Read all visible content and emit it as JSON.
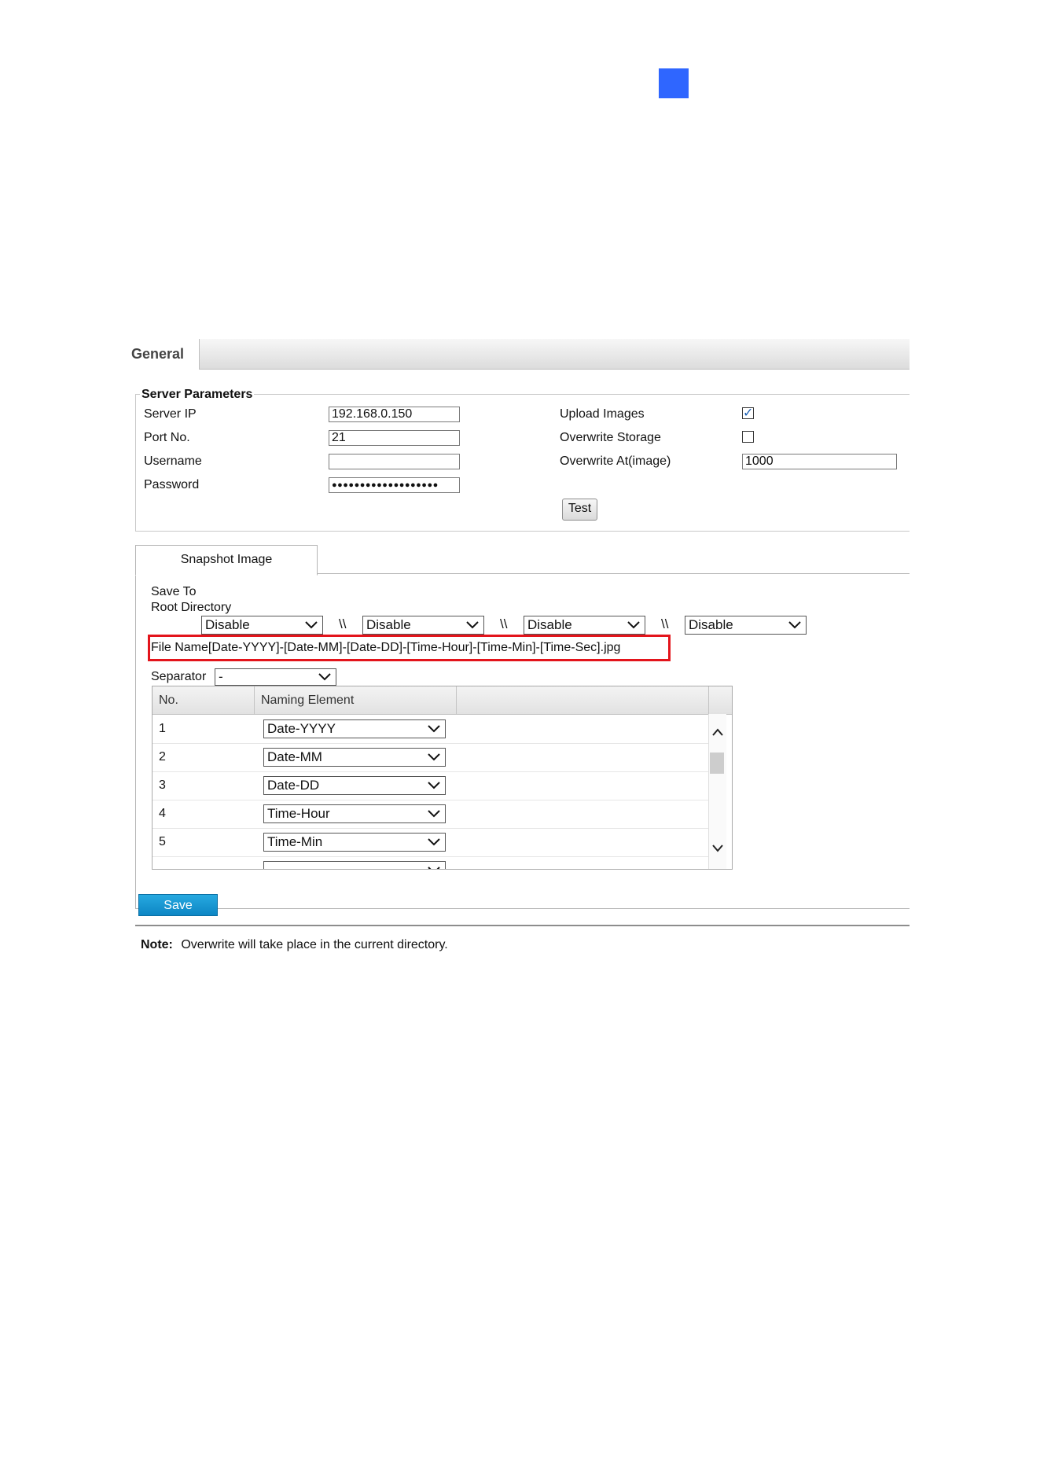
{
  "tabs": {
    "general": "General"
  },
  "server": {
    "legend": "Server Parameters",
    "server_ip_label": "Server IP",
    "server_ip_value": "192.168.0.150",
    "port_label": "Port No.",
    "port_value": "21",
    "username_label": "Username",
    "username_value": "",
    "password_label": "Password",
    "password_value": "●●●●●●●●●●●●●●●●●●●",
    "upload_images_label": "Upload Images",
    "upload_images_checked": true,
    "overwrite_storage_label": "Overwrite Storage",
    "overwrite_storage_checked": false,
    "overwrite_at_label": "Overwrite At(image)",
    "overwrite_at_value": "1000",
    "test_label": "Test"
  },
  "snapshot": {
    "tab_label": "Snapshot Image",
    "save_to_label": "Save To",
    "root_directory_label": "Root Directory",
    "directory_selects": [
      "Disable",
      "Disable",
      "Disable",
      "Disable"
    ],
    "directory_separator": "\\\\",
    "file_name": "File Name[Date-YYYY]-[Date-MM]-[Date-DD]-[Time-Hour]-[Time-Min]-[Time-Sec].jpg",
    "separator_label": "Separator",
    "separator_value": "-",
    "table": {
      "headers": [
        "No.",
        "Naming Element"
      ],
      "rows": [
        {
          "no": "1",
          "element": "Date-YYYY"
        },
        {
          "no": "2",
          "element": "Date-MM"
        },
        {
          "no": "3",
          "element": "Date-DD"
        },
        {
          "no": "4",
          "element": "Time-Hour"
        },
        {
          "no": "5",
          "element": "Time-Min"
        }
      ]
    }
  },
  "save_label": "Save",
  "note": {
    "label": "Note:",
    "text": "Overwrite will take place in the current directory."
  },
  "colors": {
    "accent_square": "#2f66ff",
    "highlight_box": "#e3141b",
    "save_button": "#1a9ad6"
  }
}
